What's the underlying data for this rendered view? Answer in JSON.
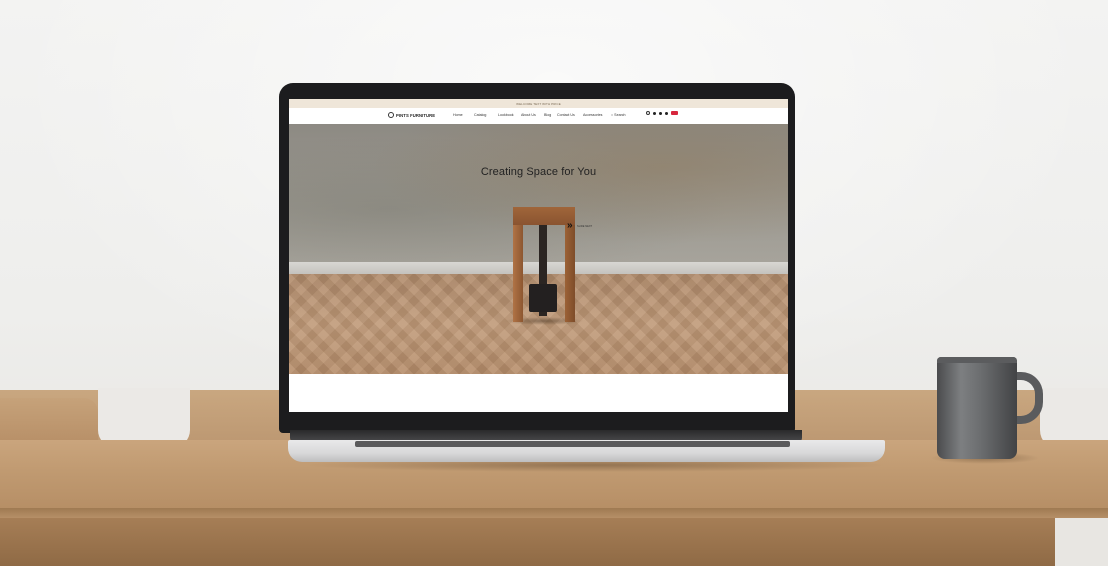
{
  "screen": {
    "announcement_text": "WELCOME TEXT WITH PRICE",
    "logo_text": "PINTS FURNITURE",
    "nav": {
      "items": [
        {
          "label": "Home"
        },
        {
          "label": "Catalog"
        },
        {
          "label": "Lookbook"
        },
        {
          "label": "About Us"
        },
        {
          "label": "Blog"
        },
        {
          "label": "Contact Us"
        },
        {
          "label": "Accessories"
        }
      ],
      "search_label": "Search"
    },
    "hero": {
      "title": "Creating Space for You",
      "slider_arrow": "»",
      "slider_label": "SLIDE NEXT"
    }
  },
  "colors": {
    "announcement_bg": "#efe6d9",
    "flag": "#d7263d",
    "lid": "#1c1c1e"
  },
  "icons": [
    "search-icon",
    "user-icon",
    "wishlist-icon",
    "cart-icon",
    "language-flag-icon",
    "logo-mark-icon",
    "double-chevron-right-icon"
  ]
}
